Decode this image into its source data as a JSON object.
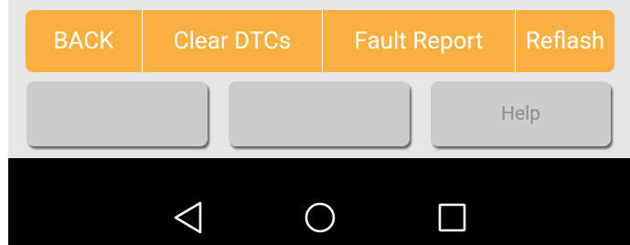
{
  "top_bar": {
    "back_label": "BACK",
    "clear_dtcs_label": "Clear DTCs",
    "fault_report_label": "Fault Report",
    "reflash_label": "Reflash"
  },
  "secondary_buttons": {
    "button1_label": "",
    "button2_label": "",
    "help_label": "Help"
  },
  "nav_bar": {
    "icons": [
      "back-triangle-icon",
      "home-circle-icon",
      "recent-apps-square-icon"
    ]
  },
  "colors": {
    "accent": "#f9b041",
    "button_grey": "#cccccc",
    "app_background": "#e6e6e6",
    "nav_background": "#000000"
  }
}
